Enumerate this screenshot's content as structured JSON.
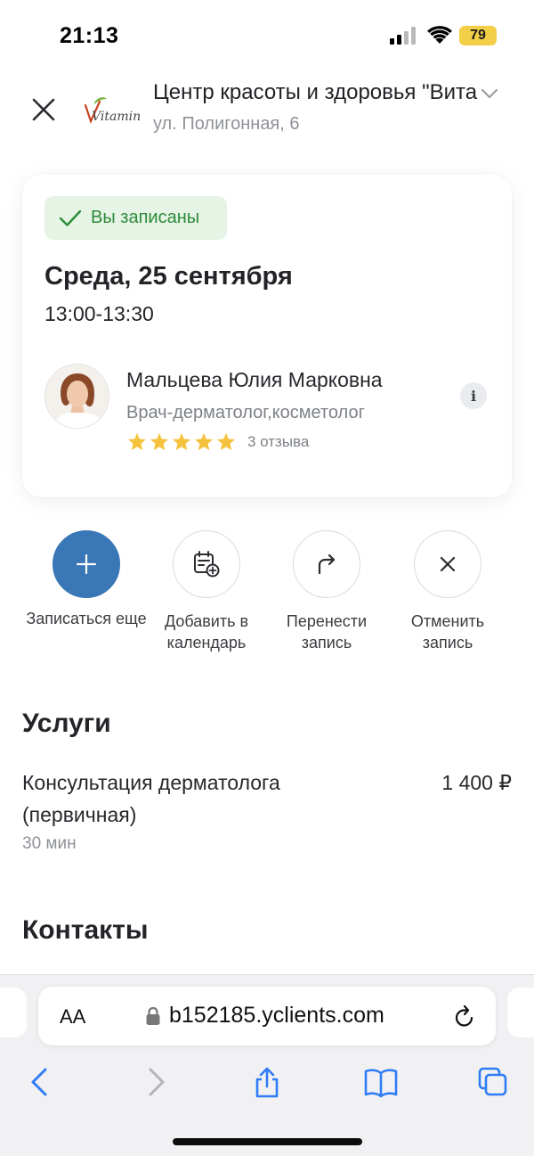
{
  "status_bar": {
    "time": "21:13",
    "battery": "79"
  },
  "header": {
    "title": "Центр красоты и здоровья \"Витамин\"",
    "address": "ул. Полигонная, 6",
    "logo_text": "Vitamin"
  },
  "appointment": {
    "status": "Вы записаны",
    "date": "Среда, 25 сентября",
    "time": "13:00-13:30",
    "staff": {
      "name": "Мальцева Юлия Марковна",
      "role": "Врач-дерматолог,косметолог",
      "rating": 5,
      "reviews": "3 отзыва"
    }
  },
  "actions": [
    {
      "label": "Записаться еще",
      "icon": "plus-icon"
    },
    {
      "label": "Добавить в календарь",
      "icon": "calendar-add-icon"
    },
    {
      "label": "Перенести запись",
      "icon": "redirect-arrow-icon"
    },
    {
      "label": "Отменить запись",
      "icon": "close-icon"
    }
  ],
  "services": {
    "title": "Услуги",
    "items": [
      {
        "name": "Консультация дерматолога (первичная)",
        "price": "1 400 ₽",
        "duration": "30 мин"
      }
    ]
  },
  "contacts": {
    "title": "Контакты"
  },
  "browser": {
    "aa": "AA",
    "url": "b152185.yclients.com"
  },
  "colors": {
    "accent": "#3a77b6",
    "success_bg": "#e5f4e4",
    "success_text": "#2d8a3b",
    "star": "#f4c23d"
  }
}
